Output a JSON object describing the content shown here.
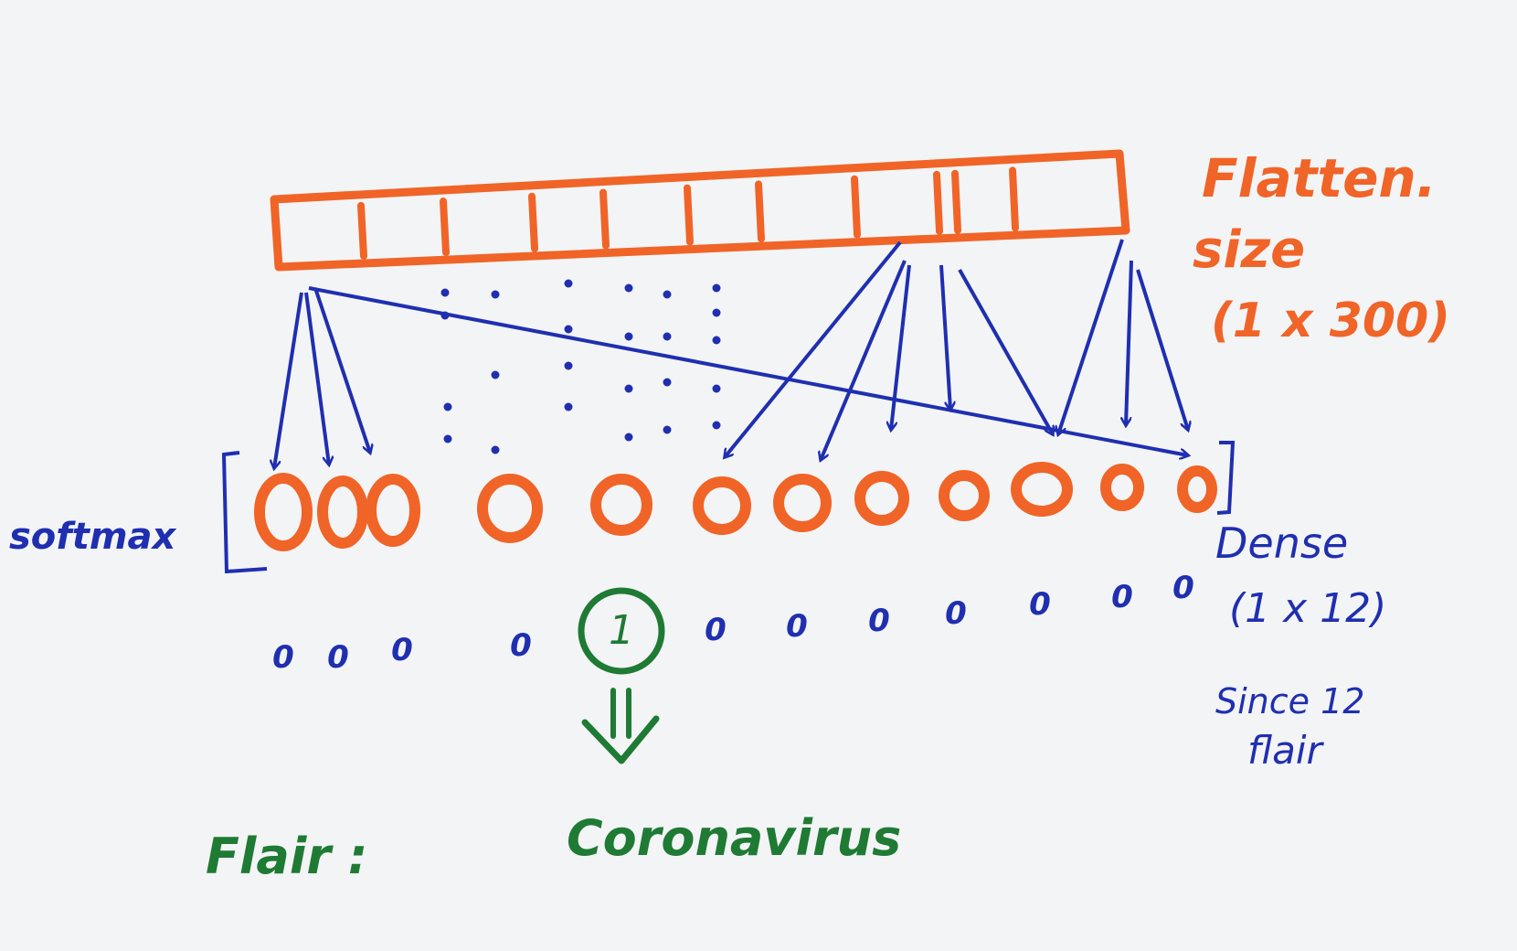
{
  "colors": {
    "orange": "#f06428",
    "blue": "#1f2fb0",
    "green": "#1f7a34",
    "paper": "#f3f4f6"
  },
  "labels": {
    "flatten_line1": "Flatten.",
    "flatten_line2": "size",
    "flatten_line3": "(1 x 300)",
    "softmax": "softmax",
    "dense_line1": "Dense",
    "dense_line2": "(1 x 12)",
    "since_line1": "Since 12",
    "since_line2": "flair",
    "flair": "Flair :",
    "result": "Coronavirus"
  },
  "output_vector": [
    "0",
    "0",
    "0",
    "0",
    "1",
    "0",
    "0",
    "0",
    "0",
    "0",
    "0",
    "0"
  ],
  "selected_index": 4
}
